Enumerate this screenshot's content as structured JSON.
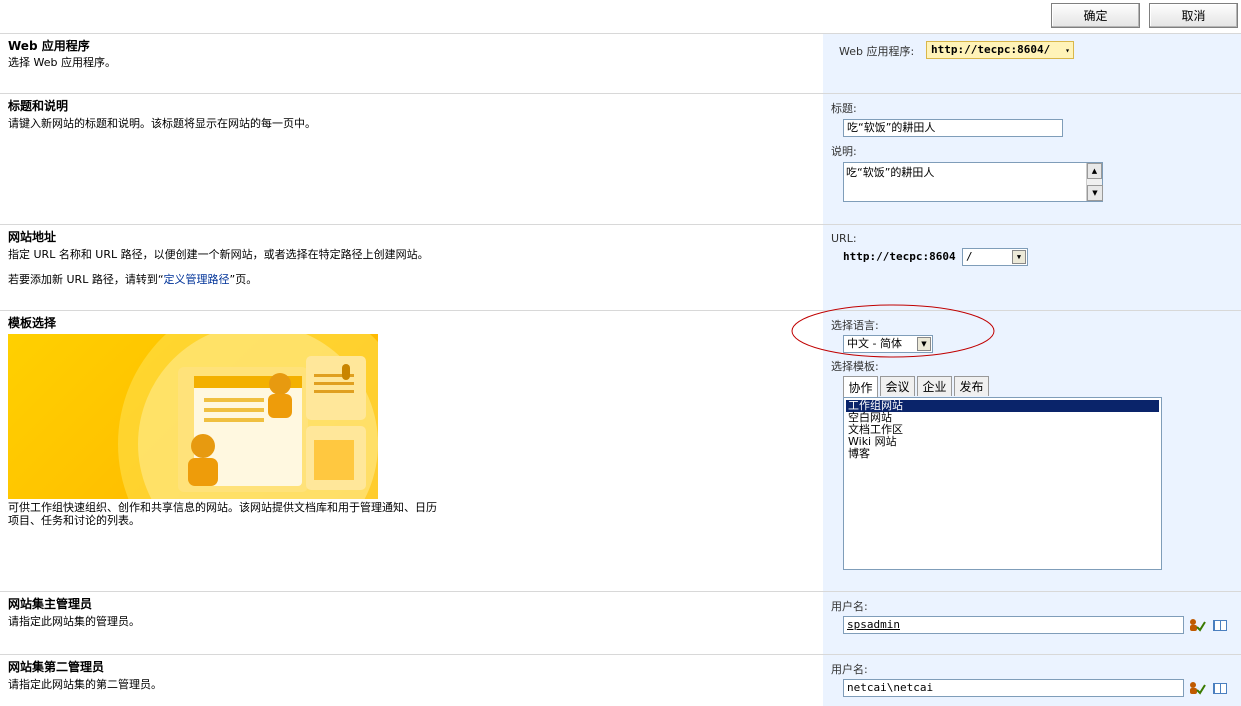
{
  "toolbar": {
    "ok_label": "确定",
    "cancel_label": "取消"
  },
  "sections": {
    "webapp": {
      "title": "Web 应用程序",
      "desc": "选择 Web 应用程序。",
      "field_label": "Web 应用程序:",
      "value": "http://tecpc:8604/"
    },
    "title_desc": {
      "title": "标题和说明",
      "desc": "请键入新网站的标题和说明。该标题将显示在网站的每一页中。",
      "title_label": "标题:",
      "title_value": "吃“软饭”的耕田人",
      "desc_label": "说明:",
      "desc_value": "吃“软饭”的耕田人"
    },
    "address": {
      "title": "网站地址",
      "desc": "指定 URL 名称和 URL 路径，以便创建一个新网站，或者选择在特定路径上创建网站。",
      "desc2_prefix": "若要添加新 URL 路径，请转到“",
      "desc2_link": "定义管理路径",
      "desc2_suffix": "”页。",
      "url_label": "URL:",
      "url_prefix": "http://tecpc:8604",
      "path_value": "/"
    },
    "template": {
      "title": "模板选择",
      "desc_line1": "可供工作组快速组织、创作和共享信息的网站。该网站提供文档库和用于管理通知、日历",
      "desc_line2": "项目、任务和讨论的列表。",
      "lang_label": "选择语言:",
      "lang_value": "中文 - 简体",
      "tmpl_label": "选择模板:",
      "tabs": [
        "协作",
        "会议",
        "企业",
        "发布"
      ],
      "items": [
        "工作组网站",
        "空白网站",
        "文档工作区",
        "Wiki 网站",
        "博客"
      ]
    },
    "primary_admin": {
      "title": "网站集主管理员",
      "desc": "请指定此网站集的管理员。",
      "user_label": "用户名:",
      "user_value": "spsadmin"
    },
    "secondary_admin": {
      "title": "网站集第二管理员",
      "desc": "请指定此网站集的第二管理员。",
      "user_label": "用户名:",
      "user_value": "netcai\\netcai"
    }
  },
  "colors": {
    "right_pane": "#ebf3ff",
    "selected": "#0a246a",
    "highlight_circle": "#c00000",
    "link": "#003399"
  }
}
